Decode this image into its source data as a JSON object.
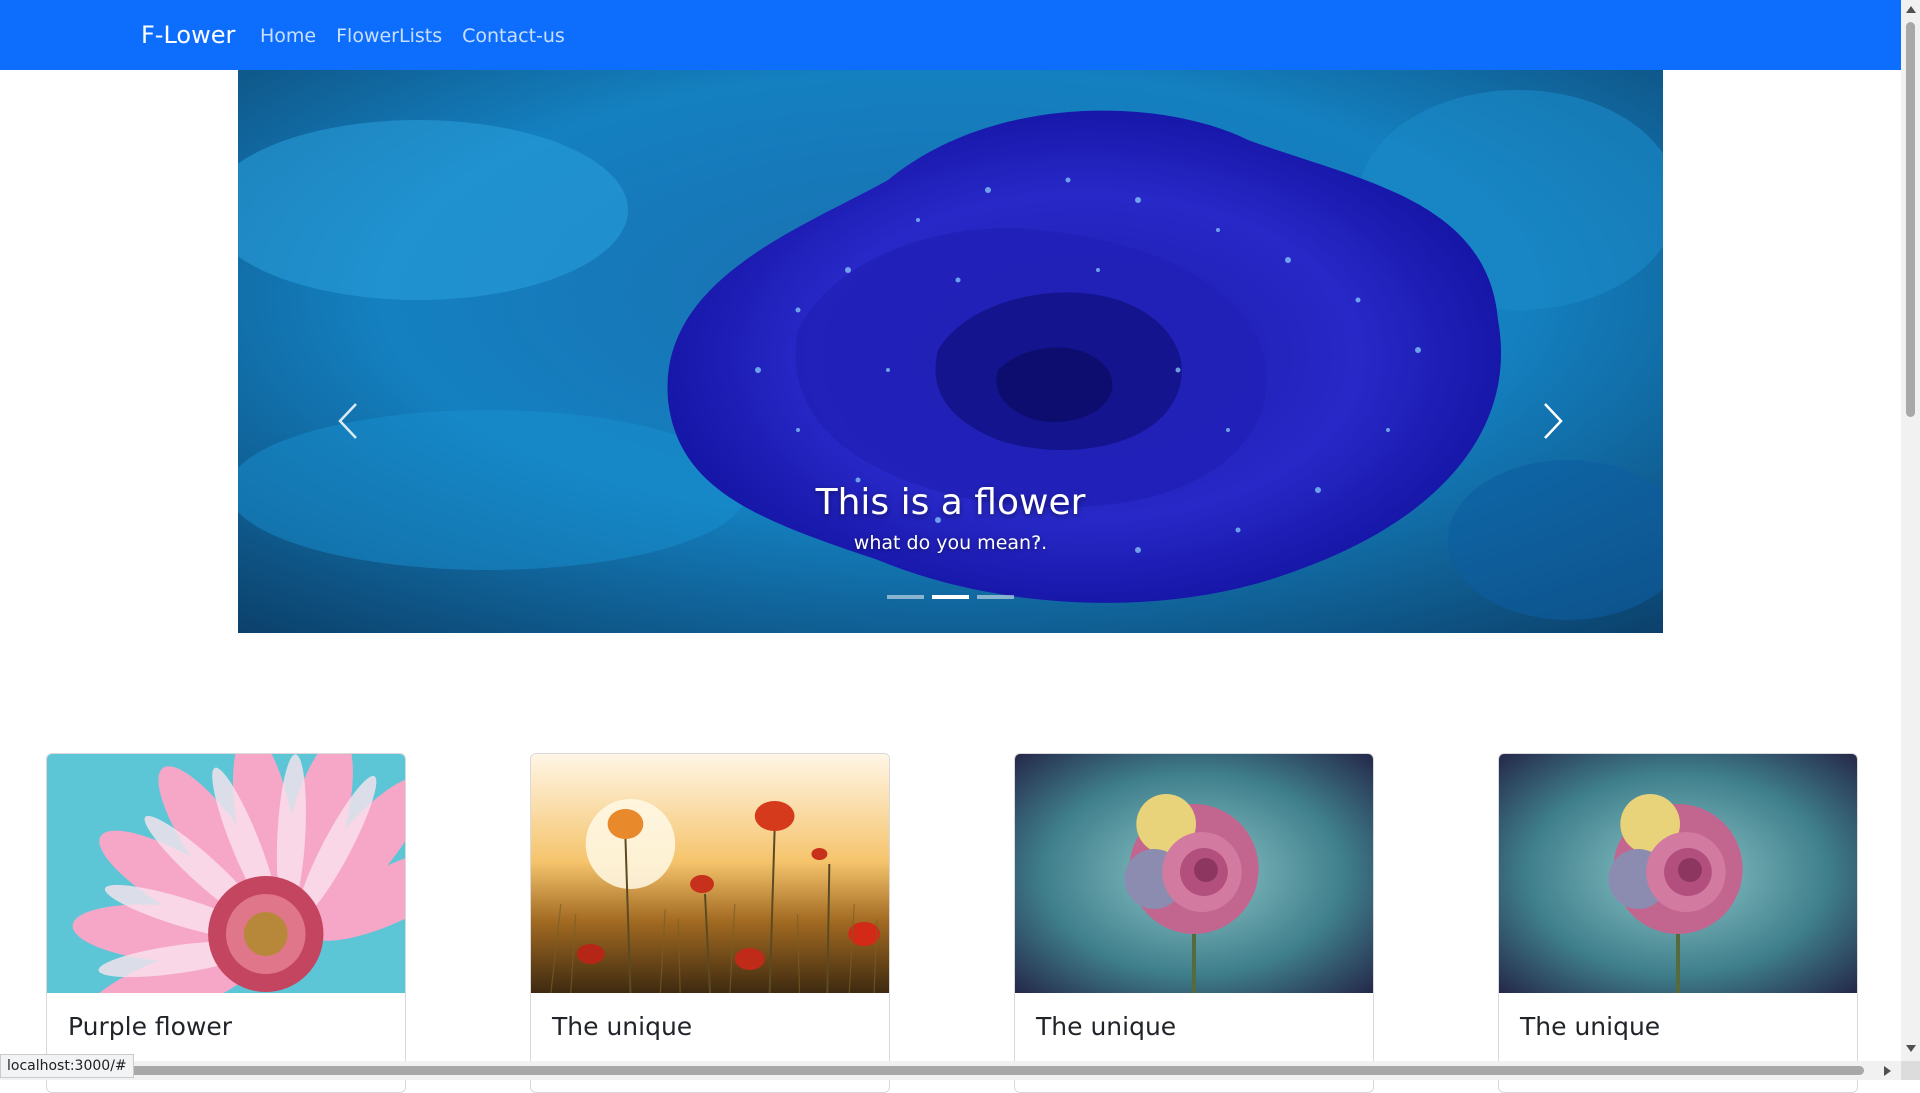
{
  "navbar": {
    "brand": "F-Lower",
    "links": [
      "Home",
      "FlowerLists",
      "Contact-us"
    ]
  },
  "carousel": {
    "caption_title": "This is a flower",
    "caption_text": "what do you mean?.",
    "slide_count": 3,
    "active_slide": 2,
    "prev_icon": "chevron-left-icon",
    "next_icon": "chevron-right-icon"
  },
  "cards": [
    {
      "title": "Purple flower",
      "image": "pink-daisy-photo"
    },
    {
      "title": "The unique",
      "image": "poppy-field-photo"
    },
    {
      "title": "The unique",
      "image": "rose-photo"
    },
    {
      "title": "The unique",
      "image": "rose-photo"
    }
  ],
  "status_bar": {
    "url": "localhost:3000/#"
  },
  "colors": {
    "navbar": "#0d6efd",
    "nav_text": "#ffffff"
  }
}
